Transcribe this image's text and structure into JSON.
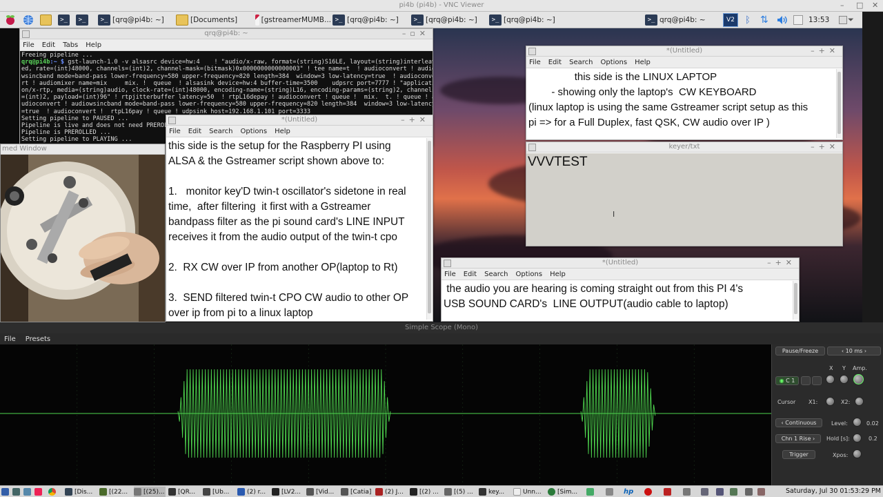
{
  "vnc": {
    "title": "pi4b (pi4b) - VNC Viewer",
    "min": "–",
    "max": "□",
    "close": "✕"
  },
  "taskbar_top": {
    "tasks": [
      "[qrq@pi4b: ~]",
      "[Documents]",
      "[gstreamerMUMB...",
      "[qrq@pi4b: ~]",
      "[qrq@pi4b: ~]",
      "[qrq@pi4b: ~]",
      "qrq@pi4b: ~"
    ],
    "clock": "13:53"
  },
  "terminal": {
    "title": "qrq@pi4b: ~",
    "menu": [
      "File",
      "Edit",
      "Tabs",
      "Help"
    ],
    "line1": "Freeing pipeline ...",
    "prompt_user": "qrq@pi4b",
    "prompt_path": ":~ $",
    "command": " gst-launch-1.0 -v alsasrc device=hw:4    ! \"audio/x-raw, format=(string)S16LE, layout=(string)interleav",
    "lines": [
      "ed, rate=(int)48000, channels=(int)2, channel-mask=(bitmask)0x0000000000000003\" ! tee name=t  ! audioconvert ! audio",
      "wsincband mode=band-pass lower-frequency=580 upper-frequency=820 length=384  window=3 low-latency=true  ! audioconve",
      "rt ! audiomixer name=mix     mix. !  queue  ! alsasink device=hw:4 buffer-time=3500    udpsrc port=7777 ! \"applicati",
      "on/x-rtp, media=(string)audio, clock-rate=(int)48000, encoding-name=(string)L16, encoding-params=(string)2, channels",
      "=(int)2, payload=(int)96\" ! rtpjitterbuffer latency=50  ! rtpL16depay ! audioconvert ! queue !  mix.  t. ! queue ! a",
      "udioconvert ! audiowsincband mode=band-pass lower-frequency=580 upper-frequency=820 length=384  window=3 low-latency",
      "=true  ! audioconvert !  rtpL16pay ! queue ! udpsink host=192.168.1.101 port=3333",
      "Setting pipeline to PAUSED ...",
      "Pipeline is live and does not need PREROLL",
      "Pipeline is PREROLLED ...",
      "Setting pipeline to PLAYING ..."
    ]
  },
  "camera": {
    "title": "med Window"
  },
  "editor_pi": {
    "title": "*(Untitled)",
    "menu": [
      "File",
      "Edit",
      "Search",
      "Options",
      "Help"
    ],
    "text": "this side is the setup for the Raspberry PI using\nALSA & the Gstreamer script shown above to:\n\n1.   monitor key'D twin-t oscillator's sidetone in real\ntime,  after filtering  it first with a Gstreamer\nbandpass filter as the pi sound card's LINE INPUT\nreceives it from the audio output of the twin-t cpo\n\n2.  RX CW over IP from another OP(laptop to Rt)\n\n3.  SEND filtered twin-t CPO CW audio to other OP\nover ip from pi to a linux laptop"
  },
  "editor_laptop": {
    "title": "*(Untitled)",
    "menu": [
      "File",
      "Edit",
      "Search",
      "Options",
      "Help"
    ],
    "text": "                this side is the LINUX LAPTOP\n        - showing only the laptop's  CW KEYBOARD\n(linux laptop is using the same Gstreamer script setup as this\npi => for a Full Duplex, fast QSK, CW audio over IP )"
  },
  "keyer": {
    "title": "keyer/txt",
    "text": "VVVTEST"
  },
  "editor_audio": {
    "title": "*(Untitled)",
    "menu": [
      "File",
      "Edit",
      "Search",
      "Options",
      "Help"
    ],
    "text": " the audio you are hearing is coming straight out from this PI 4's\nUSB SOUND CARD's  LINE OUTPUT(audio cable to laptop)"
  },
  "scope": {
    "title": "Simple Scope (Mono)",
    "menu": [
      "File",
      "Presets"
    ],
    "pause_label": "Pause/Freeze",
    "timebase": "10 ms",
    "x_label": "X",
    "y_label": "Y",
    "amp_label": "Amp.",
    "channel_label": "C 1",
    "cursor_label": "Cursor",
    "x1_label": "X1:",
    "x2_label": "X2:",
    "mode_label": "Continuous",
    "level_label": "Level:",
    "level_value": "0.02",
    "trigger_src": "Chn 1 Rise",
    "hold_label": "Hold [s]:",
    "hold_value": "0.2",
    "trigger_btn": "Trigger",
    "xpos_label": "Xpos:",
    "colors": {
      "trace": "#4fd84f",
      "grid": "#1f3a1f"
    }
  },
  "taskbar_bottom": {
    "tasks": [
      "[Dis...",
      "[(22...",
      "[(25)...",
      "[QR...",
      "[Ub...",
      "(2) r...",
      "[LV2...",
      "[Vid...",
      "[Catia]",
      "(2) J...",
      "[(2) ...",
      "[(5) ...",
      "key...",
      "Unn...",
      "[Sim..."
    ],
    "clock": "Saturday, Jul 30 01:53:29 PM"
  }
}
